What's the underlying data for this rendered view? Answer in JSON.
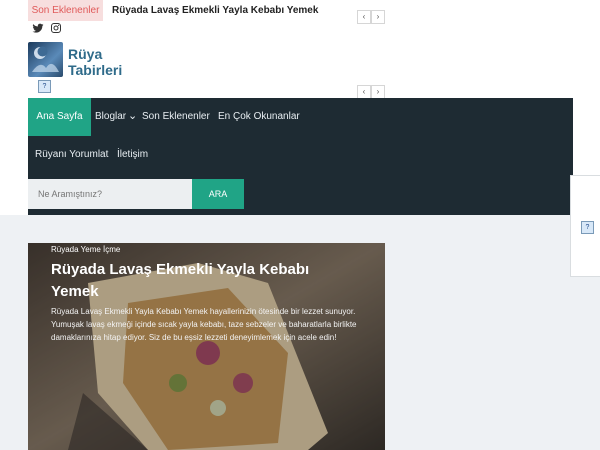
{
  "top_bar": {
    "tag": "Son Eklenenler",
    "headline": "Rüyada Lavaş Ekmekli Yayla Kebabı Yemek",
    "prev_symbol": "‹",
    "next_symbol": "›"
  },
  "social": {
    "icons": [
      "twitter-icon",
      "instagram-icon"
    ]
  },
  "logo": {
    "line1": "Rüya",
    "line2": "Tabirleri",
    "broken_image_mark": "?"
  },
  "nav": {
    "home": "Ana Sayfa",
    "blogs": "Bloglar",
    "blogs_caret": "⌄",
    "recent": "Son Eklenenler",
    "popular": "En Çok Okunanlar",
    "interpret": "Rüyanı Yorumlat",
    "contact": "İletişim"
  },
  "search": {
    "placeholder": "Ne Aramıştınız?",
    "button": "ARA"
  },
  "right_box": {
    "broken_image_mark": "?"
  },
  "featured": {
    "category": "Rüyada Yeme İçme",
    "title": "Rüyada Lavaş Ekmekli Yayla Kebabı Yemek",
    "excerpt": "Rüyada Lavaş Ekmekli Yayla Kebabı Yemek hayallerinizin ötesinde bir lezzet sunuyor. Yumuşak lavaş ekmeği içinde sıcak yayla kebabı, taze sebzeler ve baharatlarla birlikte damaklarınıza hitap ediyor. Siz de bu eşsiz lezzeti deneyimlemek için acele edin!"
  },
  "colors": {
    "accent": "#20a486",
    "nav_bg": "#1e2b33",
    "tag_bg": "#f7dede",
    "tag_fg": "#e05a5a"
  }
}
